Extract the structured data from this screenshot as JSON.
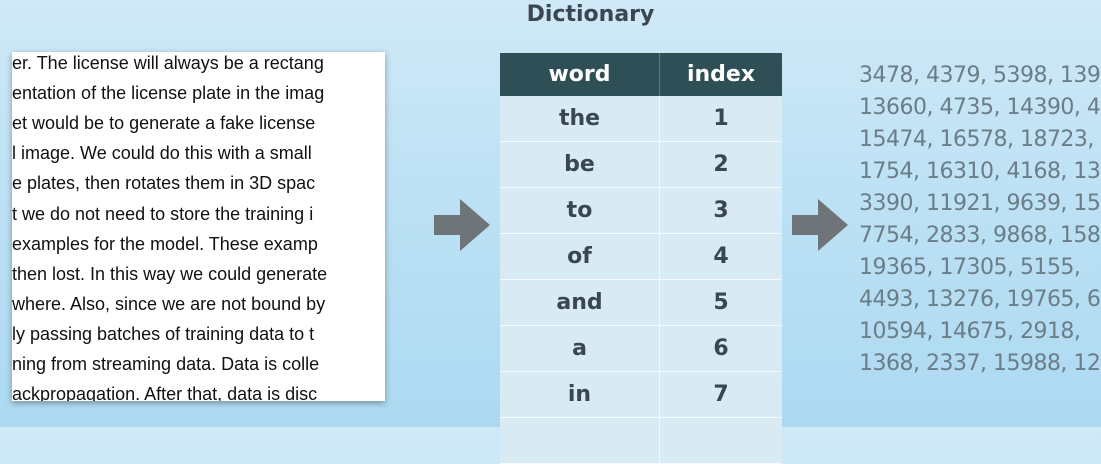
{
  "title": "Dictionary",
  "document_lines": [
    "er. The license will always be a rectang",
    "entation of the license plate in the imag",
    "et would be to generate a fake license",
    "l image. We could do this with a small",
    "e plates, then rotates them in 3D spac",
    "t we do not need to store the training i",
    "examples for the model. These examp",
    "then lost. In this way we could generate",
    "where. Also, since we are not bound by",
    "ly passing batches of training data to t",
    "ning from streaming data. Data is colle",
    "ackpropagation. After that, data is disc"
  ],
  "dictionary": {
    "headers": {
      "word": "word",
      "index": "index"
    },
    "rows": [
      {
        "word": "the",
        "index": "1"
      },
      {
        "word": "be",
        "index": "2"
      },
      {
        "word": "to",
        "index": "3"
      },
      {
        "word": "of",
        "index": "4"
      },
      {
        "word": "and",
        "index": "5"
      },
      {
        "word": "a",
        "index": "6"
      },
      {
        "word": "in",
        "index": "7"
      },
      {
        "word": "",
        "index": ""
      }
    ]
  },
  "encoded_lines": [
    "3478, 4379, 5398, 139",
    "13660, 4735, 14390, 4",
    "15474, 16578, 18723,",
    "1754, 16310, 4168, 13",
    "3390, 11921, 9639, 15",
    "7754, 2833, 9868, 158",
    "19365, 17305, 5155,",
    "4493, 13276, 19765, 6",
    "10594, 14675, 2918,",
    "1368, 2337, 15988, 12"
  ],
  "colors": {
    "header_bg": "#2f4f57",
    "row_bg": "#d8eaf3",
    "arrow": "#6f7478"
  },
  "icons": [
    "right-arrow-icon",
    "right-arrow-icon"
  ]
}
